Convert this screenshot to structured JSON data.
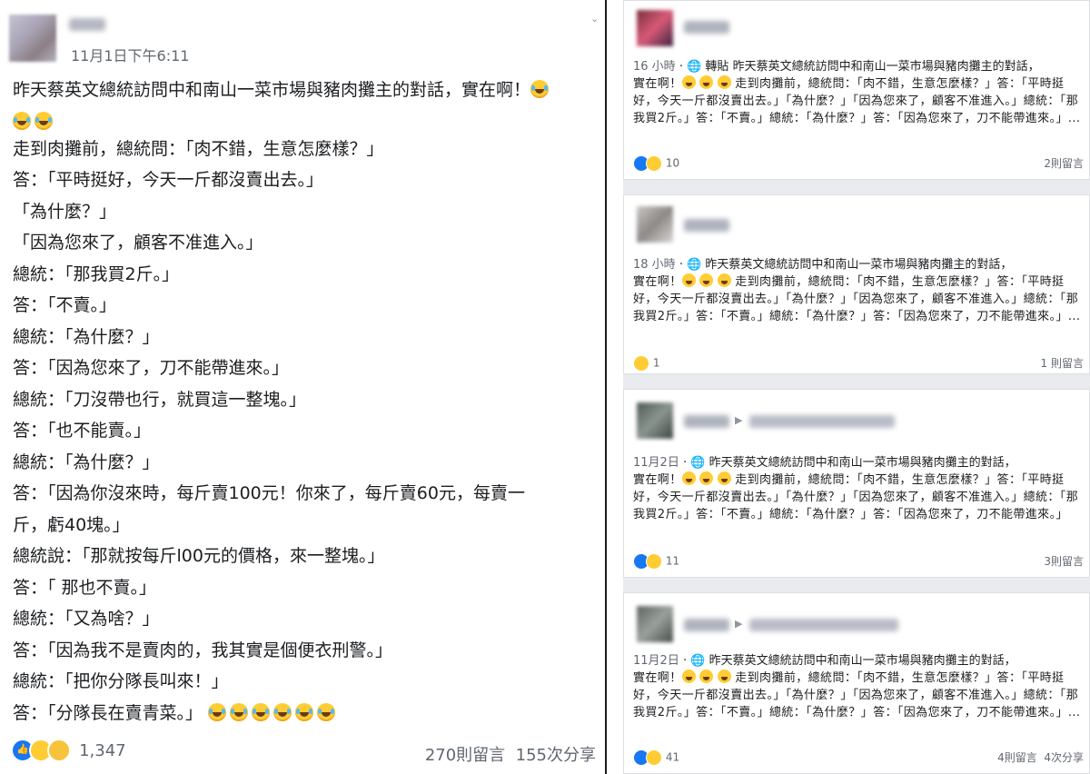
{
  "left_post": {
    "time": "11月1日下午6:11",
    "lines": [
      "昨天蔡英文總統訪問中和南山一菜市場與豬肉攤主的對話，實在啊！",
      "",
      "走到肉攤前，總統問：「肉不錯，生意怎麼樣？」",
      "答：「平時挺好，今天一斤都沒賣出去。」",
      "「為什麼？」",
      "「因為您來了，顧客不准進入。」",
      "總統：「那我買2斤。」",
      "答：「不賣。」",
      "總統：「為什麼？」",
      "答：「因為您來了，刀不能帶進來。」",
      "總統：「刀沒帶也行，就買這一整塊。」",
      "答：「也不能賣。」",
      "總統：「為什麼？」",
      "答：「因為你沒來時，每斤賣100元！你來了，每斤賣60元，每賣一",
      "斤，虧40塊。」",
      "總統說：「那就按每斤l00元的價格，來一整塊。」",
      "答：「 那也不賣。」",
      "總統：「又為啥？」",
      "答：「因為我不是賣肉的，我其實是個便衣刑警。」",
      "總統：「把你分隊長叫來！」",
      "答：「分隊長在賣青菜。」"
    ],
    "reaction_count": "1,347",
    "comments": "270則留言",
    "shares": "155次分享"
  },
  "shares": [
    {
      "time": "16 小時",
      "meta_prefix": "轉貼",
      "line1": "昨天蔡英文總統訪問中和南山一菜市場與豬肉攤主的對話，",
      "line2": "實在啊！",
      "line2b": "走到肉攤前，總統問：「肉不錯，生意怎麼樣？」答：「平時挺好，今天一斤都沒賣出去。」「為什麼？」「因為您來了，顧客不准進入。」總統：「那我買2斤。」答：「不賣。」總統：「為什麼？」答：「因為您來了，刀不能帶進來。」...",
      "reactions": "10",
      "comments": "2則留言",
      "shares": ""
    },
    {
      "time": "18 小時",
      "line1": "昨天蔡英文總統訪問中和南山一菜市場與豬肉攤主的對話，",
      "line2": "實在啊！",
      "line2b": "走到肉攤前，總統問：「肉不錯，生意怎麼樣？」答：「平時挺好，今天一斤都沒賣出去。」「為什麼？」「因為您來了，顧客不准進入。」總統：「那我買2斤。」答：「不賣。」總統：「為什麼？」答：「因為您來了，刀不能帶進來。」...",
      "reactions": "1",
      "comments": "1 則留言",
      "shares": ""
    },
    {
      "time": "11月2日",
      "line1": "昨天蔡英文總統訪問中和南山一菜市場與豬肉攤主的對話，",
      "line2": "實在啊！",
      "line2b": "走到肉攤前，總統問：「肉不錯，生意怎麼樣？」答：「平時挺好，今天一斤都沒賣出去。」「為什麼？」「因為您來了，顧客不准進入。」總統：「那我買2斤。」答：「不賣。」總統：「為什麼？」答：「因為您來了，刀不能帶進來。」",
      "reactions": "11",
      "comments": "3則留言",
      "shares": ""
    },
    {
      "time": "11月2日",
      "line1": "昨天蔡英文總統訪問中和南山一菜市場與豬肉攤主的對話，",
      "line2": "實在啊！",
      "line2b": "走到肉攤前，總統問：「肉不錯，生意怎麼樣？」答：「平時挺好，今天一斤都沒賣出去。」「為什麼？」「因為您來了，顧客不准進入。」總統：「那我買2斤。」答：「不賣。」總統：「為什麼？」答：「因為您來了，刀不能帶進來。」...",
      "reactions": "41",
      "comments": "4則留言",
      "shares": "4次分享"
    }
  ],
  "colors": {
    "facebook_blue": "#1877f2",
    "haha_yellow": "#ffcc33",
    "meta_gray": "#616770",
    "feed_bg": "#e9ebee"
  },
  "icons": [
    "globe-icon",
    "like-reaction-icon",
    "haha-reaction-icon",
    "sad-reaction-icon",
    "laughing-tears-emoji"
  ]
}
